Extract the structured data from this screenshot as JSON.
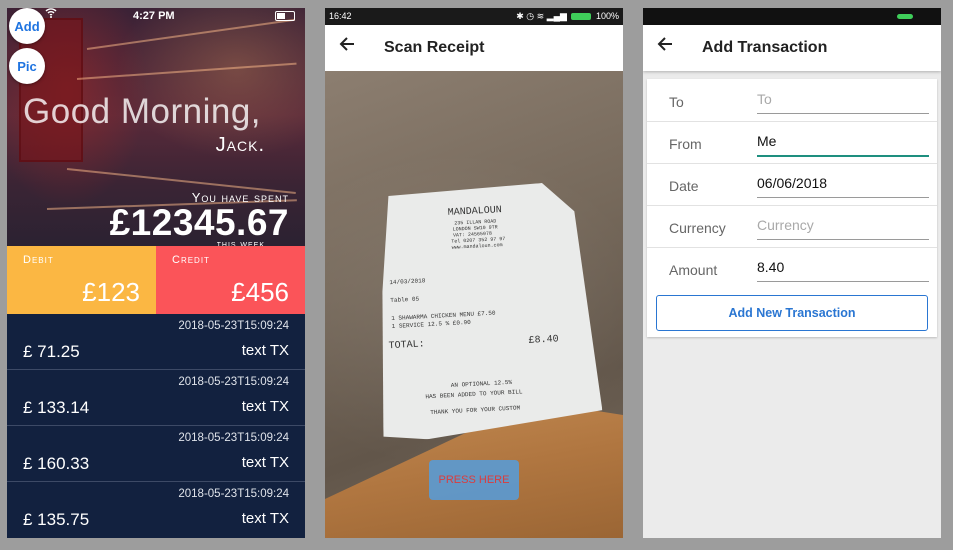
{
  "phone1": {
    "status_time": "4:27 PM",
    "add_label": "Add",
    "pic_label": "Pic",
    "greeting": "Good Morning,",
    "name": "Jack.",
    "spent_label": "You have spent",
    "spent_value": "£12345.67",
    "spent_period": "this week",
    "debit_label": "Debit",
    "debit_value": "£123",
    "credit_label": "Credit",
    "credit_value": "£456",
    "colors": {
      "debit": "#fbb743",
      "credit": "#fb5459",
      "list_bg": "#12213f"
    },
    "transactions": [
      {
        "date": "2018-05-23T15:09:24",
        "amount": "£ 71.25",
        "text": "text TX"
      },
      {
        "date": "2018-05-23T15:09:24",
        "amount": "£ 133.14",
        "text": "text TX"
      },
      {
        "date": "2018-05-23T15:09:24",
        "amount": "£ 160.33",
        "text": "text TX"
      },
      {
        "date": "2018-05-23T15:09:24",
        "amount": "£ 135.75",
        "text": "text TX"
      }
    ]
  },
  "phone2": {
    "status_time": "16:42",
    "status_battery": "100%",
    "title": "Scan Receipt",
    "press_label": "PRESS HERE",
    "receipt": {
      "merchant": "MANDALOUN",
      "address1": "235 ILLAN ROAD",
      "address2": "LONDON SW10 9TR",
      "vat": "VAT: 24565978",
      "tel": "Tel 0207 352 97 97",
      "web": "www.mandaloun.com",
      "date": "14/03/2018",
      "table": "Table 05",
      "item1": "1  SHAWARMA CHICKEN MENU     £7.50",
      "item2": "1  SERVICE 12.5 %           £0.90",
      "total_label": "TOTAL:",
      "total_value": "£8.40",
      "note1": "AN OPTIONAL 12.5%",
      "note2": "HAS BEEN ADDED TO YOUR BILL",
      "note3": "THANK YOU FOR YOUR CUSTOM"
    }
  },
  "phone3": {
    "title": "Add Transaction",
    "fields": [
      {
        "label": "To",
        "value": "",
        "placeholder": "To"
      },
      {
        "label": "From",
        "value": "Me",
        "placeholder": ""
      },
      {
        "label": "Date",
        "value": "06/06/2018",
        "placeholder": ""
      },
      {
        "label": "Currency",
        "value": "",
        "placeholder": "Currency"
      },
      {
        "label": "Amount",
        "value": "8.40",
        "placeholder": ""
      }
    ],
    "button_label": "Add New Transaction",
    "accent": "#2a76d2",
    "focus_color": "#1e8f7f"
  }
}
